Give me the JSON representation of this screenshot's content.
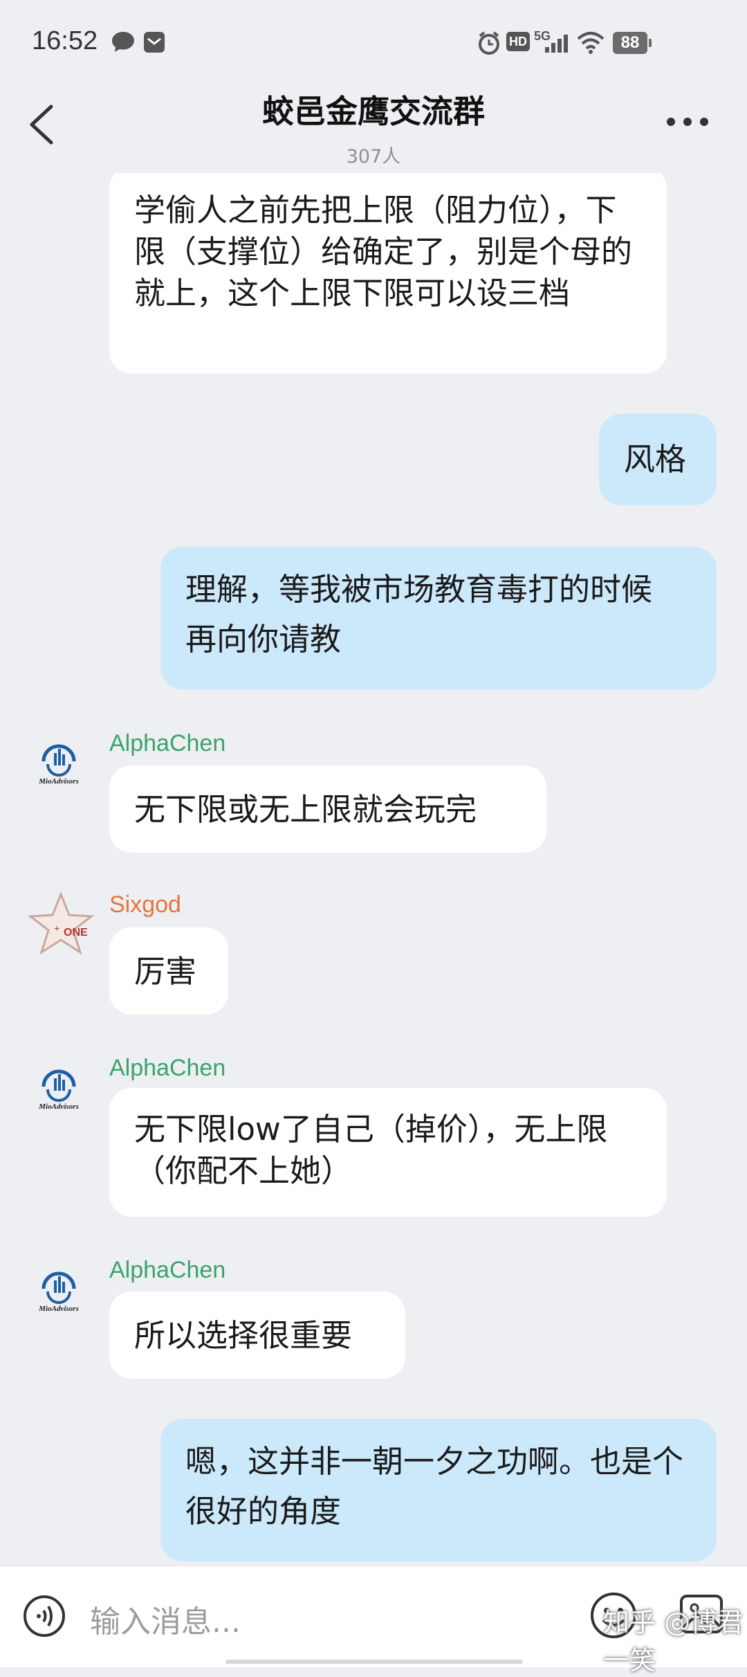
{
  "status_bar": {
    "time": "16:52",
    "network": "5G",
    "hd": "HD",
    "battery": "88"
  },
  "header": {
    "title": "蛟邑金鹰交流群",
    "member_count": "307人"
  },
  "avatars": {
    "mio_text": "MioAdvisors",
    "sixgod_text": "ONE"
  },
  "messages": [
    {
      "sender": "",
      "side": "in",
      "text": "学偷人之前先把上限（阻力位），下限（支撑位）给确定了，别是个母的就上，这个上限下限可以设三档"
    },
    {
      "sender": "",
      "side": "out",
      "text": "风格"
    },
    {
      "sender": "",
      "side": "out",
      "text": "理解，等我被市场教育毒打的时候 再向你请教"
    },
    {
      "sender": "AlphaChen",
      "side": "in",
      "text": "无下限或无上限就会玩完"
    },
    {
      "sender": "Sixgod",
      "side": "in",
      "text": "厉害"
    },
    {
      "sender": "AlphaChen",
      "side": "in",
      "text": "无下限low了自己（掉价），无上限（你配不上她）"
    },
    {
      "sender": "AlphaChen",
      "side": "in",
      "text": "所以选择很重要"
    },
    {
      "sender": "",
      "side": "out",
      "text": "嗯，这并非一朝一夕之功啊。也是个很好的角度"
    }
  ],
  "input": {
    "placeholder": "输入消息..."
  },
  "watermark": "知乎 @博君一笑",
  "colors": {
    "background": "#eeeff3",
    "incoming_bubble": "#ffffff",
    "outgoing_bubble": "#cce8fb",
    "alphachen_name": "#3aa36a",
    "sixgod_name": "#e8743b"
  }
}
